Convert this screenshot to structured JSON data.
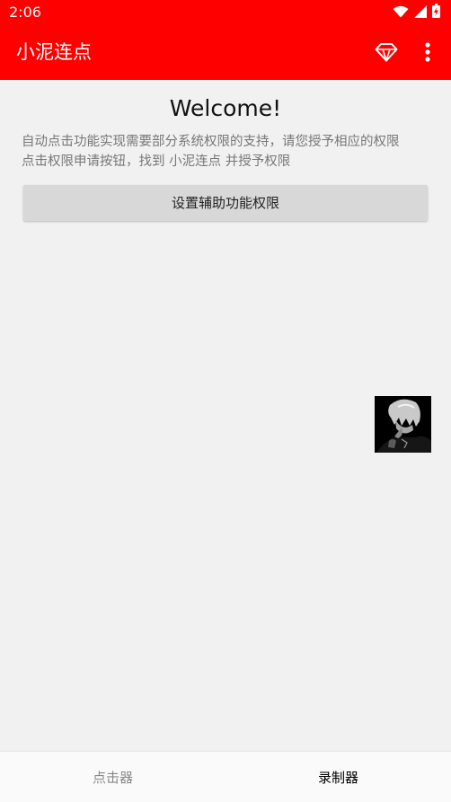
{
  "status_bar": {
    "time": "2:06",
    "icons": [
      "wifi-icon",
      "signal-icon",
      "battery-icon"
    ]
  },
  "app_bar": {
    "title": "小泥连点",
    "actions": [
      "gem-icon",
      "more-vert-icon"
    ]
  },
  "main": {
    "welcome": "Welcome!",
    "intro_line1": "自动点击功能实现需要部分系统权限的支持，请您授予相应的权限",
    "intro_line2": "点击权限申请按钮，找到 小泥连点 并授予权限",
    "grant_button": "设置辅助功能权限"
  },
  "floating_widget": {
    "icon": "anime-avatar-image"
  },
  "bottom_nav": {
    "tabs": [
      {
        "label": "点击器",
        "active": false
      },
      {
        "label": "录制器",
        "active": true
      }
    ]
  },
  "colors": {
    "primary": "#ff0000",
    "background": "#f1f1f1",
    "button": "#d8d8d8",
    "intro_text": "#777777"
  }
}
